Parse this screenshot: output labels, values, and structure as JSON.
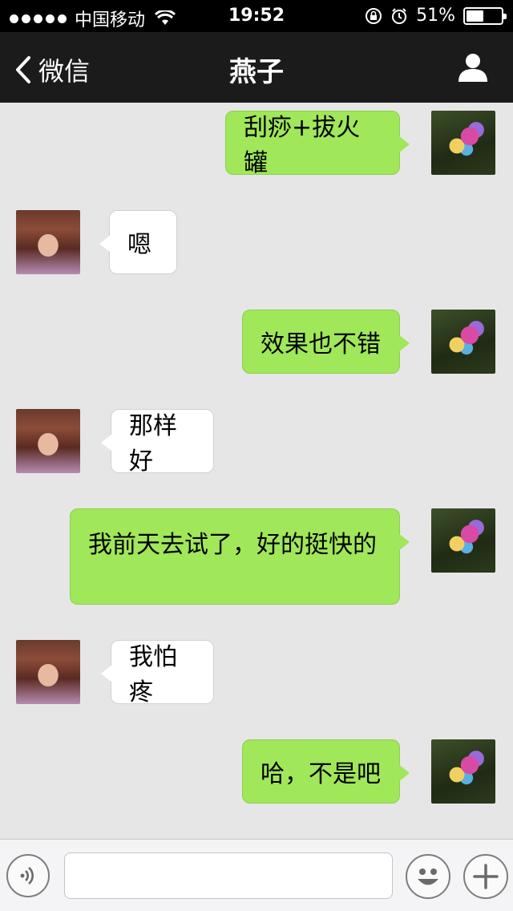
{
  "status_bar": {
    "carrier": "中国移动",
    "time": "19:52",
    "battery_percent_label": "51%",
    "battery_level": 0.51,
    "icons": [
      "signal-dots-icon",
      "wifi-icon",
      "rotation-lock-icon",
      "alarm-icon",
      "battery-icon"
    ]
  },
  "nav": {
    "back_label": "微信",
    "title": "燕子",
    "right_icon": "profile-icon"
  },
  "messages": [
    {
      "direction": "out",
      "text": "刮痧+拔火罐"
    },
    {
      "direction": "in",
      "text": "嗯"
    },
    {
      "direction": "out",
      "text": "效果也不错"
    },
    {
      "direction": "in",
      "text": "那样好"
    },
    {
      "direction": "out",
      "text": "我前天去试了，好的挺快的"
    },
    {
      "direction": "in",
      "text": "我怕疼"
    },
    {
      "direction": "out",
      "text": "哈，不是吧"
    }
  ],
  "input_bar": {
    "text_value": "",
    "icons": [
      "voice-icon",
      "emoji-icon",
      "plus-icon"
    ]
  },
  "colors": {
    "outgoing_bubble": "#a0e75a",
    "incoming_bubble": "#ffffff",
    "nav_background": "#1b1b1b",
    "chat_background": "#e6e6e6"
  }
}
